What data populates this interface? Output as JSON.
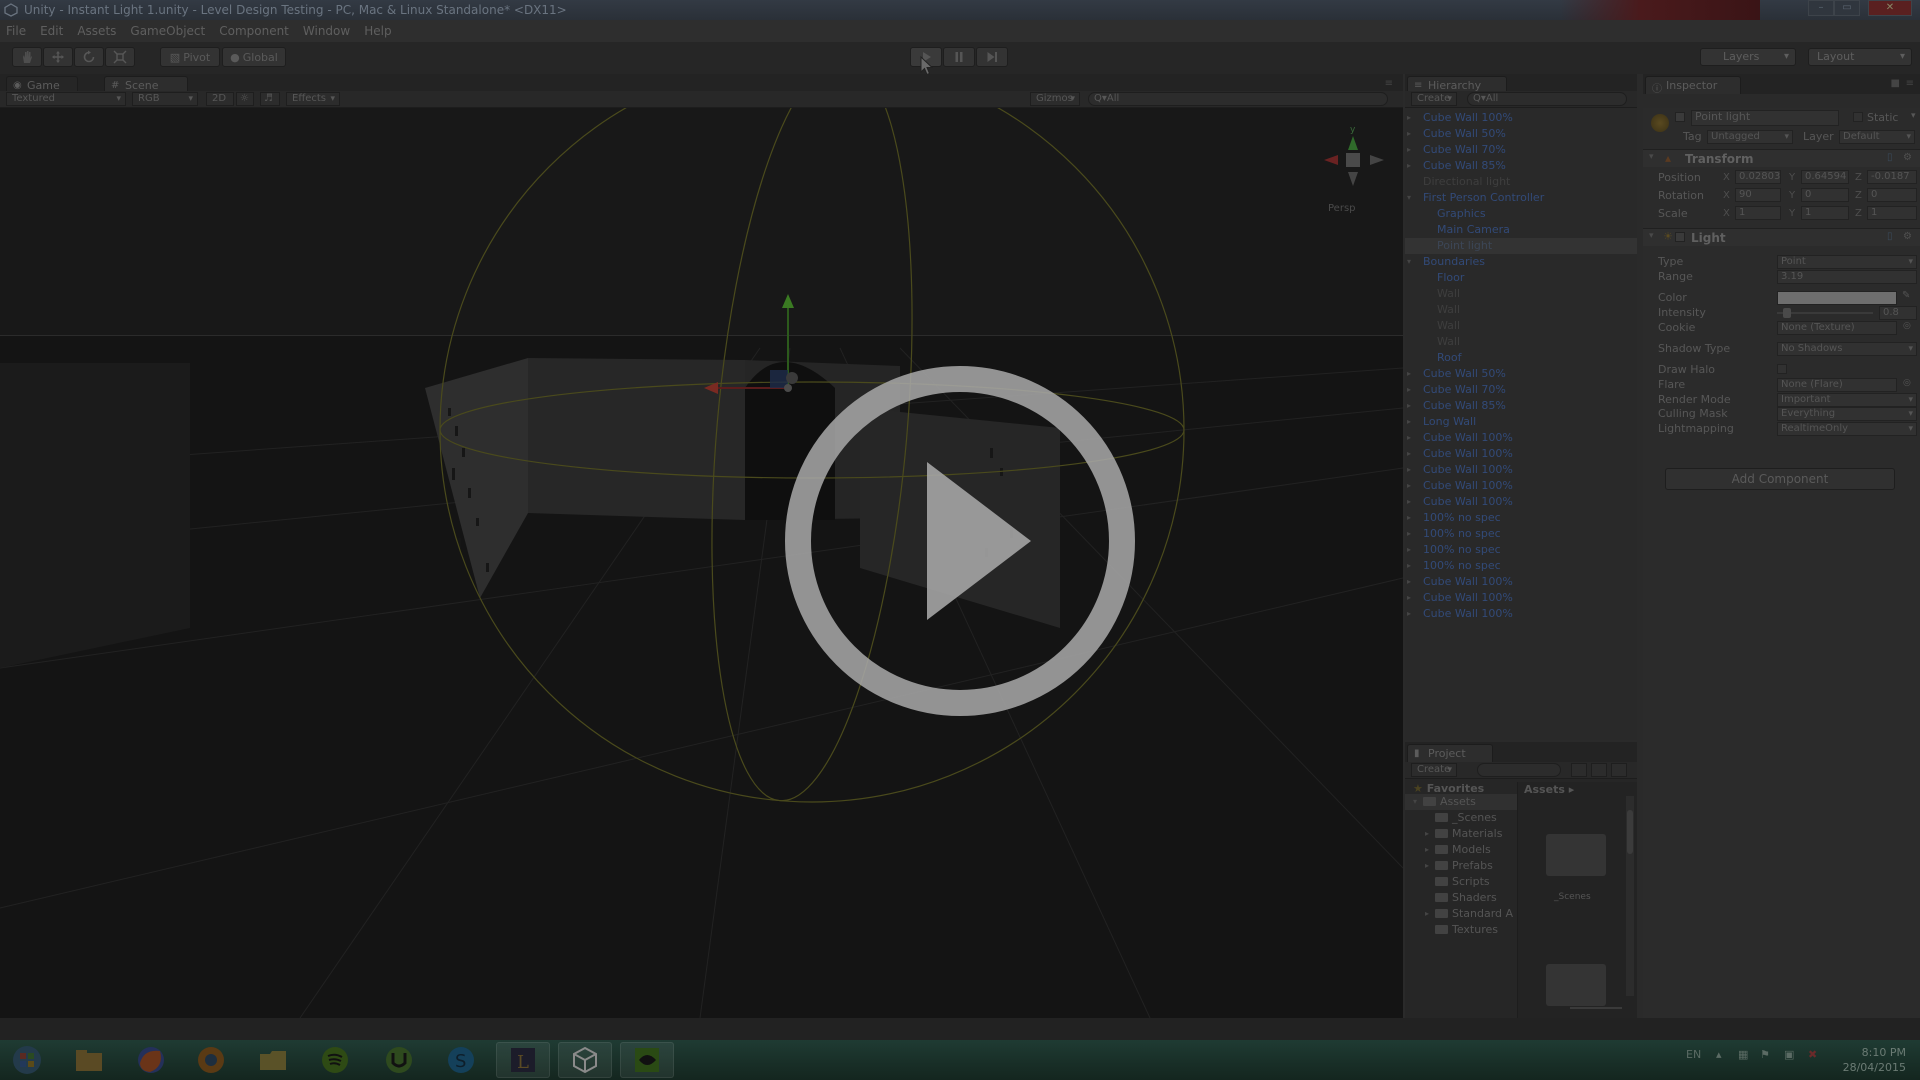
{
  "window": {
    "title": "Unity - Instant Light 1.unity - Level Design Testing - PC, Mac & Linux Standalone* <DX11>",
    "controls": [
      "–",
      "▭",
      "✕"
    ]
  },
  "menu": [
    "File",
    "Edit",
    "Assets",
    "GameObject",
    "Component",
    "Window",
    "Help"
  ],
  "toolbar": {
    "pivot_label": "Pivot",
    "global_label": "Global",
    "layers_label": "Layers",
    "layout_label": "Layout"
  },
  "scene_tabs": {
    "game": "Game",
    "scene": "Scene"
  },
  "scene_bar": {
    "shading": "Textured",
    "render_mode": "RGB",
    "mode_2d": "2D",
    "effects": "Effects",
    "gizmos": "Gizmos",
    "search_placeholder": "Q▾All"
  },
  "gizmo": {
    "persp_label": "Persp",
    "y_axis": "y"
  },
  "hierarchy": {
    "tab": "Hierarchy",
    "create": "Create",
    "search_placeholder": "Q▾All",
    "items": [
      {
        "label": "Cube Wall 100%",
        "indent": 0,
        "fold": true
      },
      {
        "label": "Cube Wall 50%",
        "indent": 0,
        "fold": true
      },
      {
        "label": "Cube Wall 70%",
        "indent": 0,
        "fold": true
      },
      {
        "label": "Cube Wall 85%",
        "indent": 0,
        "fold": true
      },
      {
        "label": "Directional light",
        "indent": 0,
        "fold": false,
        "dim": true
      },
      {
        "label": "First Person Controller",
        "indent": 0,
        "fold": true,
        "open": true
      },
      {
        "label": "Graphics",
        "indent": 1,
        "fold": false
      },
      {
        "label": "Main Camera",
        "indent": 1,
        "fold": false
      },
      {
        "label": "Point light",
        "indent": 1,
        "fold": false,
        "selected": true
      },
      {
        "label": "Boundaries",
        "indent": 0,
        "fold": true,
        "open": true
      },
      {
        "label": "Floor",
        "indent": 1,
        "fold": false
      },
      {
        "label": "Wall",
        "indent": 1,
        "fold": false,
        "dim": true
      },
      {
        "label": "Wall",
        "indent": 1,
        "fold": false,
        "dim": true
      },
      {
        "label": "Wall",
        "indent": 1,
        "fold": false,
        "dim": true
      },
      {
        "label": "Wall",
        "indent": 1,
        "fold": false,
        "dim": true
      },
      {
        "label": "Roof",
        "indent": 1,
        "fold": false
      },
      {
        "label": "Cube Wall 50%",
        "indent": 0,
        "fold": true
      },
      {
        "label": "Cube Wall 70%",
        "indent": 0,
        "fold": true
      },
      {
        "label": "Cube Wall 85%",
        "indent": 0,
        "fold": true
      },
      {
        "label": "Long Wall",
        "indent": 0,
        "fold": true
      },
      {
        "label": "Cube Wall 100%",
        "indent": 0,
        "fold": true
      },
      {
        "label": "Cube Wall 100%",
        "indent": 0,
        "fold": true
      },
      {
        "label": "Cube Wall 100%",
        "indent": 0,
        "fold": true
      },
      {
        "label": "Cube Wall 100%",
        "indent": 0,
        "fold": true
      },
      {
        "label": "Cube Wall 100%",
        "indent": 0,
        "fold": true
      },
      {
        "label": "100% no spec",
        "indent": 0,
        "fold": true
      },
      {
        "label": "100% no spec",
        "indent": 0,
        "fold": true
      },
      {
        "label": "100% no spec",
        "indent": 0,
        "fold": true
      },
      {
        "label": "100% no spec",
        "indent": 0,
        "fold": true
      },
      {
        "label": "Cube Wall 100%",
        "indent": 0,
        "fold": true
      },
      {
        "label": "Cube Wall 100%",
        "indent": 0,
        "fold": true
      },
      {
        "label": "Cube Wall 100%",
        "indent": 0,
        "fold": true
      }
    ]
  },
  "project": {
    "tab": "Project",
    "create": "Create",
    "favorites": "Favorites",
    "assets_header": "Assets",
    "tree": [
      {
        "label": "Assets",
        "indent": 0,
        "open": true,
        "selected": true
      },
      {
        "label": "_Scenes",
        "indent": 1
      },
      {
        "label": "Materials",
        "indent": 1,
        "fold": true
      },
      {
        "label": "Models",
        "indent": 1,
        "fold": true
      },
      {
        "label": "Prefabs",
        "indent": 1,
        "fold": true
      },
      {
        "label": "Scripts",
        "indent": 1
      },
      {
        "label": "Shaders",
        "indent": 1
      },
      {
        "label": "Standard A",
        "indent": 1,
        "fold": true
      },
      {
        "label": "Textures",
        "indent": 1
      }
    ],
    "grid_label": "_Scenes"
  },
  "inspector": {
    "tab": "Inspector",
    "object_name": "Point light",
    "static_label": "Static",
    "tag_label": "Tag",
    "tag_value": "Untagged",
    "layer_label": "Layer",
    "layer_value": "Default",
    "transform": {
      "header": "Transform",
      "position_label": "Position",
      "rotation_label": "Rotation",
      "scale_label": "Scale",
      "position": [
        "0.02803",
        "0.64594",
        "-0.0187"
      ],
      "rotation": [
        "90",
        "0",
        "0"
      ],
      "scale": [
        "1",
        "1",
        "1"
      ]
    },
    "light": {
      "header": "Light",
      "rows": [
        {
          "label": "Type",
          "value": "Point",
          "kind": "dropdown"
        },
        {
          "label": "Range",
          "value": "3.19",
          "kind": "text"
        },
        {
          "label": "Color",
          "value": "",
          "kind": "color"
        },
        {
          "label": "Intensity",
          "value": "0.8",
          "kind": "slider",
          "level": 0.1
        },
        {
          "label": "Cookie",
          "value": "None (Texture)",
          "kind": "object"
        },
        {
          "label": "Shadow Type",
          "value": "No Shadows",
          "kind": "dropdown"
        },
        {
          "label": "Draw Halo",
          "value": "",
          "kind": "checkbox"
        },
        {
          "label": "Flare",
          "value": "None (Flare)",
          "kind": "object"
        },
        {
          "label": "Render Mode",
          "value": "Important",
          "kind": "dropdown"
        },
        {
          "label": "Culling Mask",
          "value": "Everything",
          "kind": "dropdown"
        },
        {
          "label": "Lightmapping",
          "value": "RealtimeOnly",
          "kind": "dropdown"
        }
      ]
    },
    "add_component": "Add Component"
  },
  "taskbar": {
    "language": "EN",
    "time": "8:10 PM",
    "date": "28/04/2015"
  },
  "colors": {
    "overlay_play": "#a9a9a9",
    "hier_text": "#324a78",
    "taskbar": "#1f3b33"
  }
}
